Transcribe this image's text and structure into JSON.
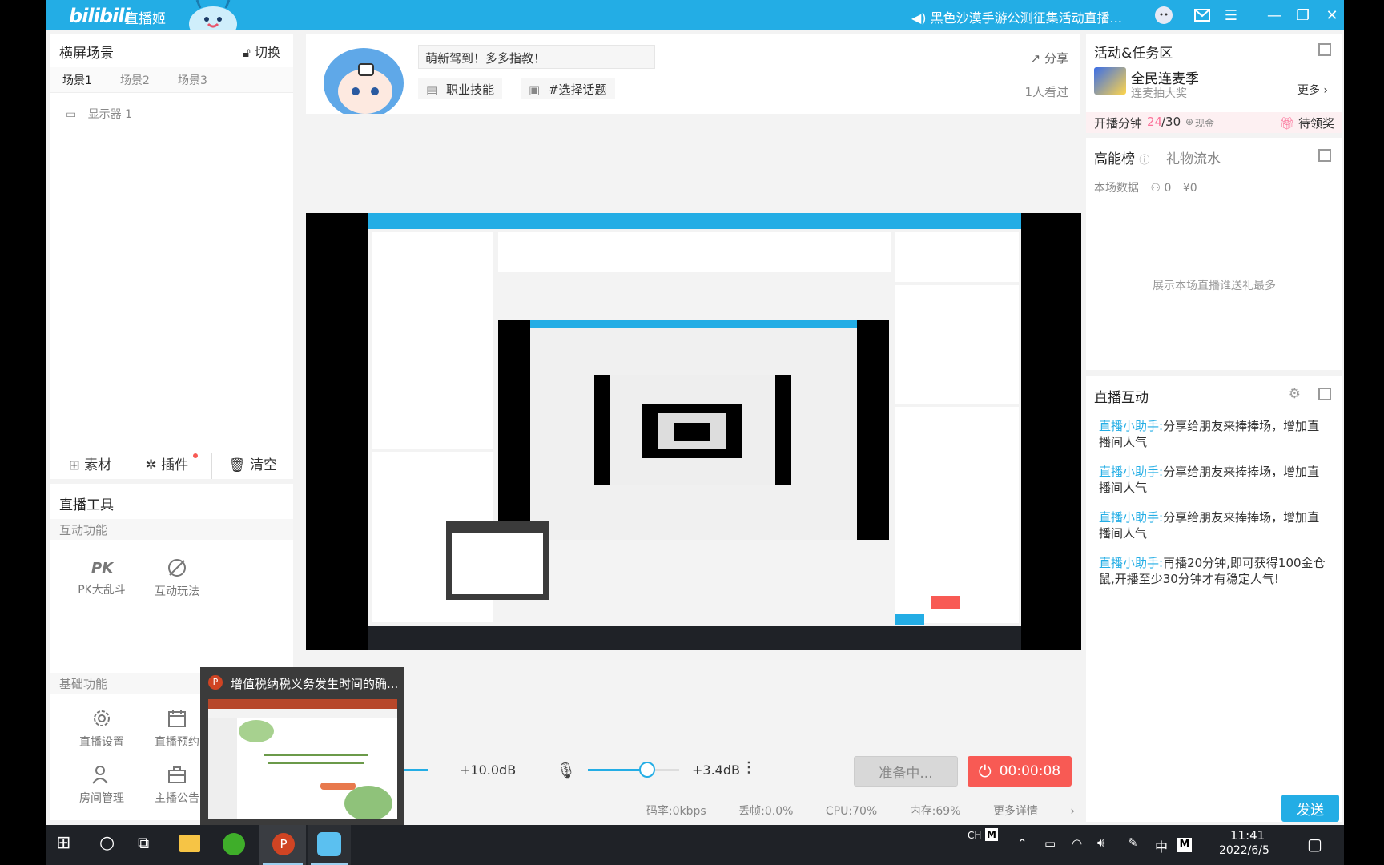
{
  "titlebar": {
    "logo": "bilibili",
    "app_name": "直播姬",
    "notice": "黑色沙漠手游公测征集活动直播..."
  },
  "scene_panel": {
    "title": "横屏场景",
    "switch_label": "切换",
    "tabs": [
      "场景1",
      "场景2",
      "场景3"
    ],
    "sources": [
      "显示器 1"
    ],
    "actions": {
      "material": "素材",
      "plugin": "插件",
      "clear": "清空"
    }
  },
  "tools": {
    "title": "直播工具",
    "interactive_header": "互动功能",
    "interactive": [
      "PK大乱斗",
      "互动玩法"
    ],
    "basic_header": "基础功能",
    "basic": [
      "直播设置",
      "直播预约",
      "房间管理",
      "主播公告"
    ]
  },
  "room": {
    "title_input": "萌新驾到！多多指教！",
    "tag_skill": "职业技能",
    "tag_topic": "#选择话题",
    "share": "分享",
    "viewers": "1人看过"
  },
  "activity": {
    "title": "活动&任务区",
    "event_name": "全民连麦季",
    "event_sub": "连麦抽大奖",
    "more": "更多",
    "task_label": "开播分钟",
    "task_done": "24",
    "task_total": "/30",
    "task_reward": "现金",
    "claim": "待领奖"
  },
  "rank": {
    "title": "高能榜",
    "tab_gift": "礼物流水",
    "stats_label": "本场数据",
    "stat_people": "0",
    "stat_money": "¥0",
    "empty": "展示本场直播谁送礼最多"
  },
  "interaction": {
    "title": "直播互动",
    "messages": [
      {
        "who": "直播小助手:",
        "text": "分享给朋友来捧捧场，增加直播间人气"
      },
      {
        "who": "直播小助手:",
        "text": "分享给朋友来捧捧场，增加直播间人气"
      },
      {
        "who": "直播小助手:",
        "text": "分享给朋友来捧捧场，增加直播间人气"
      },
      {
        "who": "直播小助手:",
        "text": "再播20分钟,即可获得100金仓鼠,开播至少30分钟才有稳定人气!"
      }
    ],
    "send": "发送"
  },
  "bottom": {
    "speaker_db": "+10.0dB",
    "mic_db": "+3.4dB",
    "speaker_level": 0.45,
    "mic_level": 0.65,
    "prepare": "准备中...",
    "live_time": "00:00:08",
    "bitrate": "码率:0kbps",
    "dropped": "丢帧:0.0%",
    "cpu": "CPU:70%",
    "memory": "内存:69%",
    "more_details": "更多详情"
  },
  "popup": {
    "title": "增值税纳税义务发生时间的确..."
  },
  "taskbar": {
    "ime_ch": "CH",
    "ime_m": "M",
    "lang": "中",
    "time": "11:41",
    "date": "2022/6/5"
  },
  "colors": {
    "accent": "#23ade5",
    "live_red": "#f85a54",
    "pink": "#fb7299"
  }
}
